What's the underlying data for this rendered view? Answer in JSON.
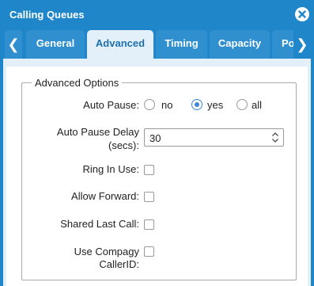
{
  "window": {
    "title": "Calling Queues"
  },
  "tabs": [
    {
      "label": "General",
      "active": false
    },
    {
      "label": "Advanced",
      "active": true
    },
    {
      "label": "Timing",
      "active": false
    },
    {
      "label": "Capacity",
      "active": false
    },
    {
      "label": "Po",
      "active": false
    }
  ],
  "icons": {
    "close": "close-circle-icon",
    "tab_prev": "chevron-left-icon",
    "tab_next": "chevron-right-icon"
  },
  "arrows": {
    "prev": "❮",
    "next": "❯"
  },
  "advanced": {
    "legend": "Advanced Options",
    "auto_pause": {
      "label": "Auto Pause:",
      "options": [
        "no",
        "yes",
        "all"
      ],
      "selected": "yes"
    },
    "auto_pause_delay": {
      "label_line1": "Auto Pause Delay",
      "label_line2": "(secs):",
      "value": "30"
    },
    "ring_in_use": {
      "label": "Ring In Use:",
      "checked": false
    },
    "allow_forward": {
      "label": "Allow Forward:",
      "checked": false
    },
    "shared_last_call": {
      "label": "Shared Last Call:",
      "checked": false
    },
    "use_compagy_callerid": {
      "label_line1": "Use Compagy",
      "label_line2": "CallerID:",
      "checked": false
    }
  },
  "colors": {
    "header_blue": "#1f86c9",
    "tab_blue": "#2f8fcf",
    "active_tab_bg": "#e3f0fa",
    "active_tab_text": "#1d6fae",
    "radio_accent": "#3b86d6"
  }
}
